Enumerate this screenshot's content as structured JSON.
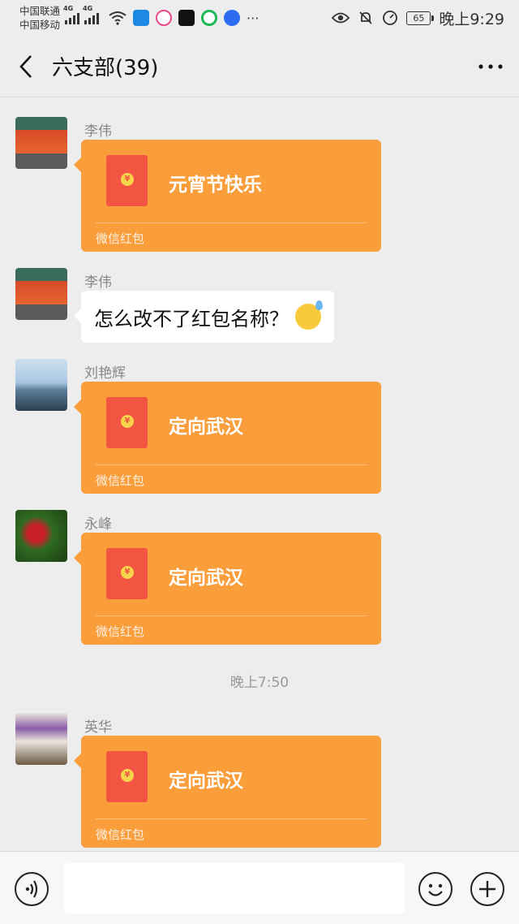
{
  "status_bar": {
    "carrier_1": "中国联通",
    "carrier_2": "中国移动",
    "network_1": "4G",
    "network_2": "4G",
    "battery": "65",
    "time": "晚上9:29"
  },
  "header": {
    "title": "六支部(39)"
  },
  "messages": [
    {
      "sender": "李伟",
      "type": "red-packet",
      "title": "元宵节快乐",
      "label": "微信红包"
    },
    {
      "sender": "李伟",
      "type": "text",
      "text": "怎么改不了红包名称？"
    },
    {
      "sender": "刘艳辉",
      "type": "red-packet",
      "title": "定向武汉",
      "label": "微信红包"
    },
    {
      "sender": "永峰",
      "type": "red-packet",
      "title": "定向武汉",
      "label": "微信红包"
    },
    {
      "type": "timestamp",
      "text": "晚上7:50"
    },
    {
      "sender": "英华",
      "type": "red-packet",
      "title": "定向武汉",
      "label": "微信红包"
    }
  ],
  "colors": {
    "red_packet_bg": "#fa9d3b",
    "envelope": "#f25643",
    "chat_bg": "#ededed"
  }
}
